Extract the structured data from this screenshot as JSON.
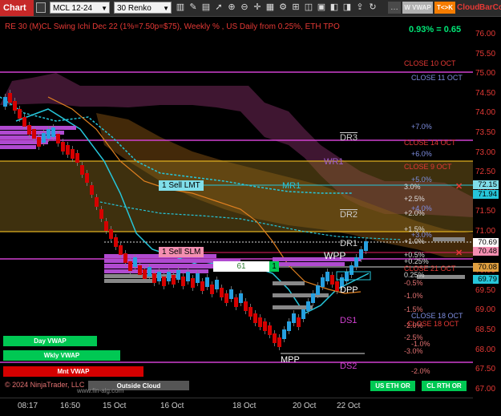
{
  "toolbar": {
    "tab_title": "Chart",
    "instrument": "MCL 12-24",
    "period": "30 Renko",
    "vwap_button": "W VWAP",
    "tax_button": "T<>K",
    "cloud_button": "Cloud",
    "bar_button": "BarCo"
  },
  "chart": {
    "title": "RE 30 (M)CL Swing Ichi Dec 22  (1%=7.50p=$75), Weekly % , US Daily from 0.25%, ETH TPO",
    "change": "0.93% = 0.65",
    "watermark": "© 2024 NinjaTrader, LLC",
    "watermark_url": "www.fin-alg.com",
    "price_ticks": [
      "76.00",
      "75.50",
      "75.00",
      "74.50",
      "74.00",
      "73.50",
      "73.00",
      "72.50",
      "72.00",
      "71.50",
      "71.00",
      "70.50",
      "70.00",
      "69.50",
      "69.00",
      "68.50",
      "68.00",
      "67.50",
      "67.00"
    ],
    "time_ticks": [
      "08:17",
      "16:50",
      "15 Oct",
      "16 Oct",
      "18 Oct",
      "20 Oct",
      "22 Oct"
    ],
    "price_markers": {
      "p1": "72.15",
      "p2": "71.94",
      "p3": "70.69",
      "p4": "70.48",
      "p5": "70.08",
      "p6": "69.79"
    },
    "levels": {
      "close10": "CLOSE 10 OCT",
      "close11": "CLOSE 11 OCT",
      "close14": "CLOSE 14 OCT",
      "close9": "CLOSE 9 OCT",
      "close21": "CLOSE 21 OCT",
      "close18a": "CLOSE 18 OCT",
      "close18b": "CLOSE 18 OCT",
      "dr3": "DR3",
      "wr1": "WR1",
      "mr1": "MR1",
      "dr2": "DR2",
      "dr1": "DR1",
      "wpp": "WPP",
      "dpp": "DPP",
      "ds1": "DS1",
      "mpp": "MPP",
      "ds2": "DS2"
    },
    "pct_labels": [
      "+7.0%",
      "+6.0%",
      "+5.0%",
      "3.0%",
      "+2.5%",
      "+4.0%",
      "+2.0%",
      "+1.5%",
      "+3.0%",
      "+1.0%",
      "+0.5%",
      "+0.25%",
      "0.25%",
      "-0.5%",
      "-1.0%",
      "-1.5%",
      "-2.0%",
      "-2.5%",
      "-1.0%",
      "-3.0%",
      "-2.0%"
    ],
    "orders": {
      "sell_lmt": "1 Sell LMT",
      "sell_slm": "1 Sell SLM",
      "pos_qty": "61",
      "pos_side": "1"
    },
    "vwap_buttons": {
      "day": "Day VWAP",
      "wkly": "Wkly VWAP",
      "mnt": "Mnt VWAP",
      "outside": "Outside Cloud"
    },
    "session_buttons": {
      "eth": "US ETH OR",
      "rth": "CL RTH OR"
    },
    "colors": {
      "accent": "#c62828",
      "price": "#e53935",
      "magenta": "#d040d0",
      "gold": "#e0b020",
      "cyan": "#26c6da"
    }
  }
}
